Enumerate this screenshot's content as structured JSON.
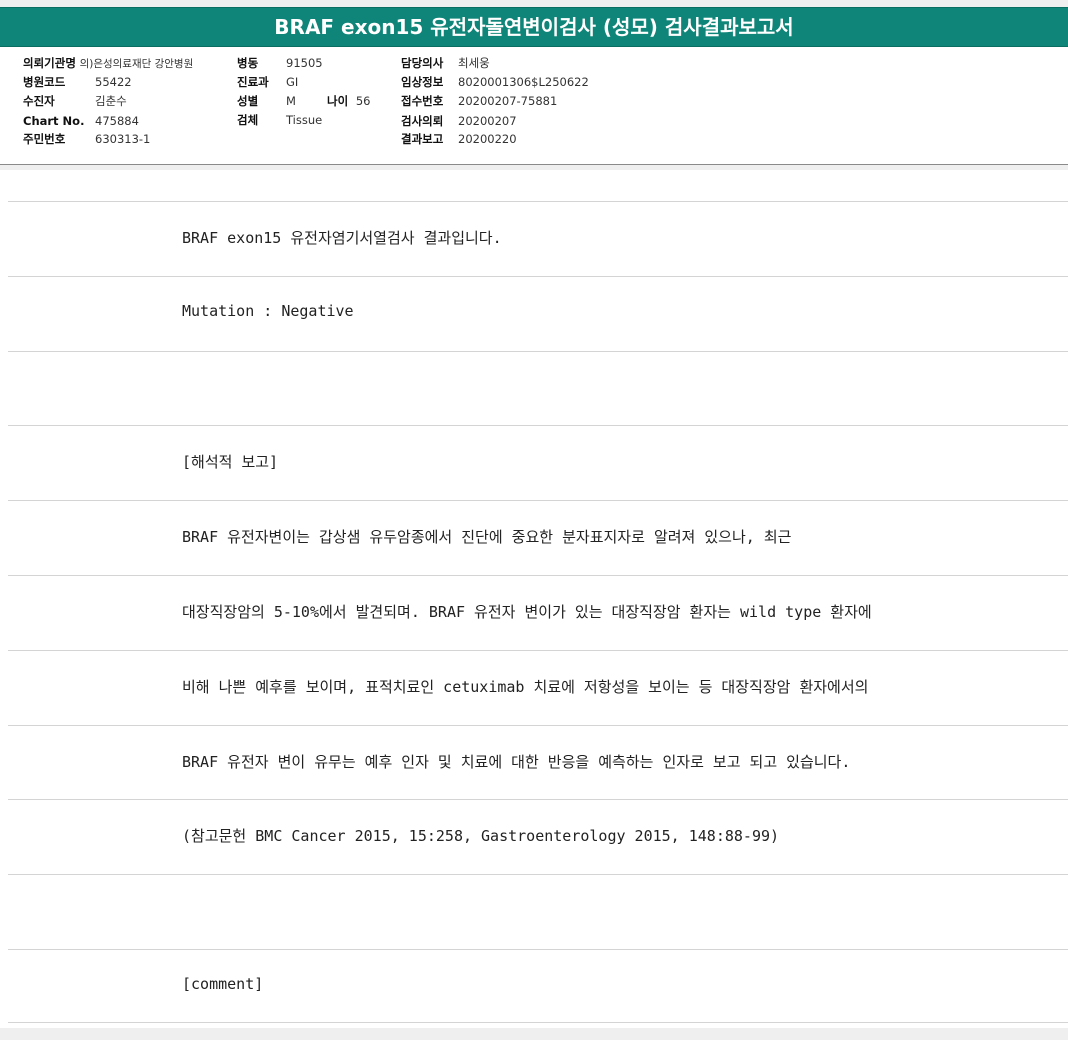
{
  "title": "BRAF exon15 유전자돌연변이검사 (성모) 검사결과보고서",
  "patient": {
    "institution_label": "의뢰기관명",
    "institution_value": "의)은성의료재단 강안병원",
    "hospital_code_label": "병원코드",
    "hospital_code_value": "55422",
    "patient_label": "수진자",
    "patient_value": "김춘수",
    "chart_label": "Chart No.",
    "chart_value": "475884",
    "resident_label": "주민번호",
    "resident_value": "630313-1",
    "ward_label": "병동",
    "ward_value": "91505",
    "dept_label": "진료과",
    "dept_value": "GI",
    "sex_label": "성별",
    "sex_value": "M",
    "age_label": "나이",
    "age_value": "56",
    "specimen_label": "검체",
    "specimen_value": "Tissue",
    "doctor_label": "담당의사",
    "doctor_value": "최세웅",
    "clinical_label": "임상정보",
    "clinical_value": "8020001306$L250622",
    "receipt_label": "접수번호",
    "receipt_value": "20200207-75881",
    "request_label": "검사의뢰",
    "request_value": "20200207",
    "report_label": "결과보고",
    "report_value": "20200220"
  },
  "lines": [
    "BRAF exon15 유전자염기서열검사 결과입니다.",
    "Mutation : Negative",
    "",
    "[해석적 보고]",
    "BRAF 유전자변이는 갑상샘 유두암종에서 진단에 중요한 분자표지자로 알려져 있으나, 최근",
    "대장직장암의 5-10%에서 발견되며. BRAF 유전자 변이가 있는 대장직장암 환자는 wild type 환자에",
    "비해 나쁜 예후를 보이며, 표적치료인 cetuximab 치료에 저항성을 보이는 등 대장직장암 환자에서의",
    "BRAF 유전자 변이 유무는 예후 인자 및 치료에 대한 반응을 예측하는 인자로 보고 되고 있습니다.",
    "(참고문헌 BMC Cancer 2015, 15:258, Gastroenterology 2015, 148:88-99)",
    "",
    "[comment]"
  ]
}
